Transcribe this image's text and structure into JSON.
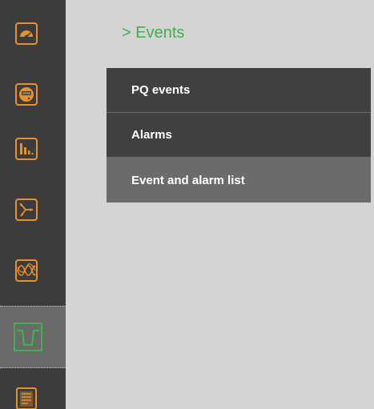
{
  "page": {
    "title": "> Events"
  },
  "sidebar": {
    "items": [
      {
        "icon": "gauge-icon"
      },
      {
        "icon": "meter-icon"
      },
      {
        "icon": "bar-chart-icon"
      },
      {
        "icon": "phasor-icon"
      },
      {
        "icon": "waveform-icon"
      },
      {
        "icon": "dip-event-icon",
        "active": true
      },
      {
        "icon": "report-icon"
      }
    ]
  },
  "menu": {
    "items": [
      {
        "label": "PQ events"
      },
      {
        "label": "Alarms"
      },
      {
        "label": "Event and alarm list",
        "selected": true
      }
    ]
  },
  "colors": {
    "accent_orange": "#e8912a",
    "accent_green": "#3fb04a",
    "sidebar_bg": "#3c3c3c",
    "menu_bg": "#404040",
    "menu_selected_bg": "#6b6b6b",
    "content_bg": "#d4d4d4"
  }
}
